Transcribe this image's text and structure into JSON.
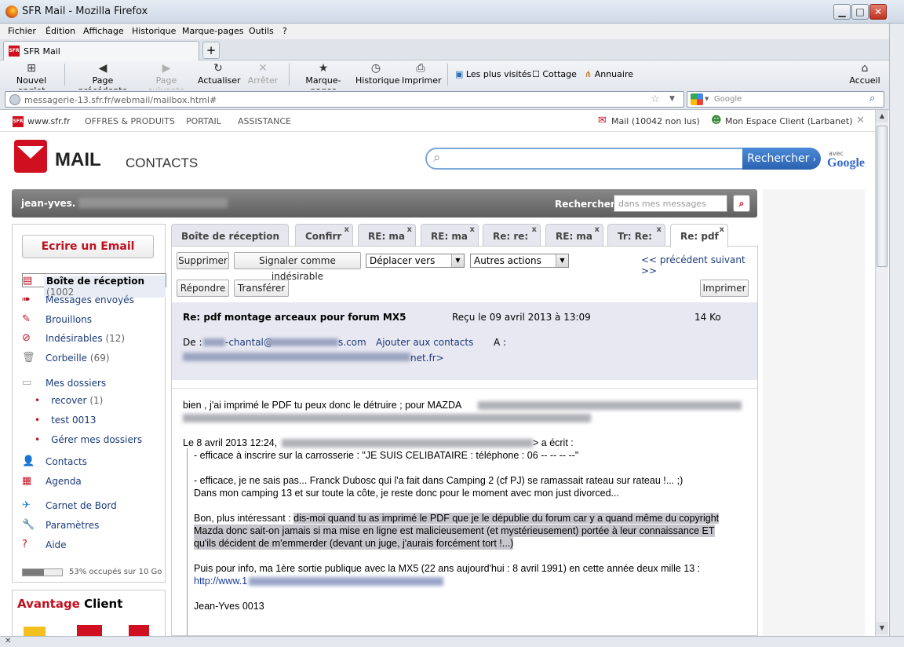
{
  "window": {
    "title": "SFR Mail - Mozilla Firefox"
  },
  "menu": [
    "Fichier",
    "Édition",
    "Affichage",
    "Historique",
    "Marque-pages",
    "Outils",
    "?"
  ],
  "browser_tab": {
    "title": "SFR Mail",
    "favicon": "SFR",
    "new_tab": "+"
  },
  "toolbar": {
    "new_tab": "Nouvel onglet",
    "back": "Page précédente",
    "forward": "Page suivante",
    "reload": "Actualiser",
    "stop": "Arrêter",
    "bookmarks": "Marque-pages",
    "history": "Historique",
    "print": "Imprimer",
    "most_visited": "Les plus visités",
    "cottage": "Cottage",
    "annuaire": "Annuaire",
    "home": "Accueil"
  },
  "urlbar": {
    "url": "messagerie-13.sfr.fr/webmail/mailbox.html#",
    "search_placeholder": "Google"
  },
  "site_nav": {
    "logo": "SFR",
    "home": "www.sfr.fr",
    "offres": "OFFRES & PRODUITS",
    "portail": "PORTAIL",
    "assistance": "ASSISTANCE",
    "mail": "Mail (10042 non lus)",
    "espace": "Mon Espace Client (Larbanet)",
    "close": "✕"
  },
  "header": {
    "mail": "MAIL",
    "contacts": "CONTACTS",
    "search_button": "Rechercher",
    "avec": "avec",
    "google": "Google"
  },
  "userbar": {
    "username": "jean-yves.",
    "search_label": "Rechercher",
    "search_placeholder": "dans mes messages"
  },
  "sidebar": {
    "compose": "Ecrire un Email",
    "folders": [
      {
        "label": "Boîte de réception",
        "count": "(1002"
      },
      {
        "label": "Messages envoyés",
        "count": ""
      },
      {
        "label": "Brouillons",
        "count": ""
      },
      {
        "label": "Indésirables",
        "count": "(12)"
      },
      {
        "label": "Corbeille",
        "count": "(69)"
      },
      {
        "label": "Mes dossiers",
        "count": ""
      }
    ],
    "subfolders": [
      {
        "label": "recover",
        "count": "(1)"
      },
      {
        "label": "test 0013",
        "count": ""
      },
      {
        "label": "Gérer mes dossiers",
        "count": ""
      }
    ],
    "tools": [
      "Contacts",
      "Agenda",
      "Carnet de Bord",
      "Paramètres",
      "Aide"
    ],
    "quota_text": "53% occupés sur 10 Go",
    "quota_fraction": 0.53,
    "avantage_a": "Avantage",
    "avantage_b": "Client"
  },
  "tabs": [
    {
      "label": "Boîte de réception",
      "closable": false
    },
    {
      "label": "Confirr",
      "closable": true
    },
    {
      "label": "RE: ma",
      "closable": true
    },
    {
      "label": "RE: ma",
      "closable": true
    },
    {
      "label": "Re: re:",
      "closable": true
    },
    {
      "label": "RE: ma",
      "closable": true
    },
    {
      "label": "Tr: Re:",
      "closable": true
    },
    {
      "label": "Re: pdf",
      "closable": true
    }
  ],
  "reader": {
    "delete": "Supprimer",
    "spam": "Signaler comme indésirable",
    "move": "Déplacer vers",
    "actions": "Autres actions",
    "pager": "<< précédent suivant >>",
    "reply": "Répondre",
    "forward": "Transférer",
    "print": "Imprimer",
    "subject": "Re: pdf montage arceaux pour forum MX5",
    "received": "Reçu le 09 avril 2013 à 13:09",
    "size": "14 Ko",
    "from_label": "De :",
    "from_value": "-chantal@",
    "from_domain": "s.com",
    "add_contact": "Ajouter aux contacts",
    "to_label": "A :",
    "to_value": "net.fr>"
  },
  "body": {
    "l1": "bien , j'ai imprimé le PDF tu peux donc le détruire ; pour MAZDA",
    "l2a": "Le 8 avril 2013 12:24,",
    "l2b": "> a écrit :",
    "l3": "- efficace à inscrire sur la carrosserie : \"JE SUIS CELIBATAIRE : téléphone : 06 -- -- -- --\"",
    "l4": "- efficace, je ne sais pas... Franck Dubosc qui l'a fait dans Camping 2 (cf PJ) se ramassait rateau sur rateau !...  ;)",
    "l5": "Dans mon camping 13 et sur toute la côte, je reste donc pour le moment avec mon just divorced...",
    "l6a": "Bon, plus intéressant :",
    "l6b": "dis-moi quand tu as imprimé le PDF que je le dépublie du forum car y a  quand même du copyright",
    "l7": "Mazda donc sait-on jamais si ma mise en ligne est malicieusement (et mystérieusement) portée à leur connaissance ET",
    "l8": "qu'ils décident de m'emmerder (devant un juge, j'aurais forcément tort !...)",
    "l9": "Puis pour info, ma 1ère sortie publique avec la MX5 (22 ans aujourd'hui : 8 avril 1991) en cette année deux mille 13 :",
    "l10": "http://www.1",
    "l11": "Jean-Yves 0013",
    "l12": "______________________________________________"
  }
}
